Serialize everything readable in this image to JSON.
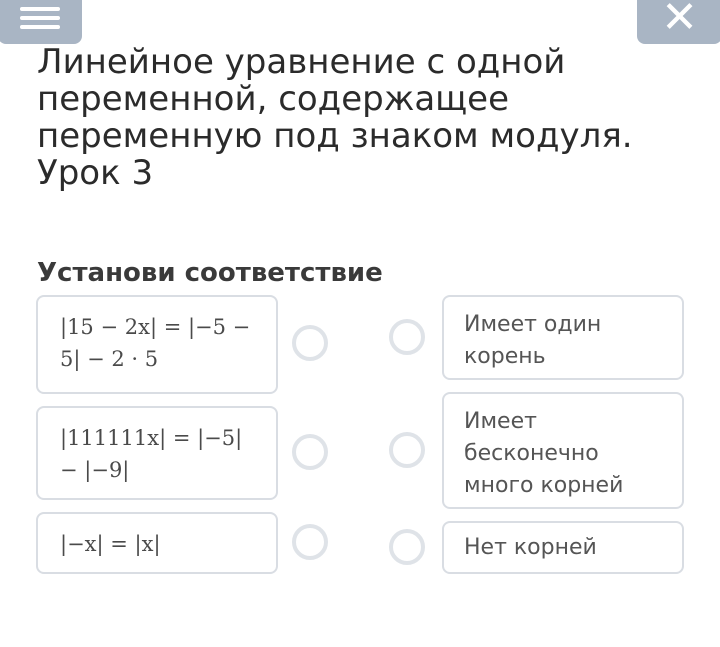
{
  "header": {
    "menu_icon": "menu-icon",
    "close_icon": "close-icon",
    "close_glyph": "✕",
    "button_color": "#a9b5c4"
  },
  "title": "Линейное уравнение с одной переменной, содержащее переменную под знаком модуля. Урок 3",
  "instruction": "Установи соответствие",
  "equations": [
    {
      "line1": "|15 − 2x| = |−5 −",
      "line2": "5| − 2 · 5"
    },
    {
      "line1": "|111111x| = |−5|",
      "line2": "− |−9|"
    },
    {
      "line1": "|−x| = |x|",
      "line2": ""
    }
  ],
  "answers": [
    "Имеет один корень",
    "Имеет бесконечно много корней",
    "Нет корней"
  ]
}
